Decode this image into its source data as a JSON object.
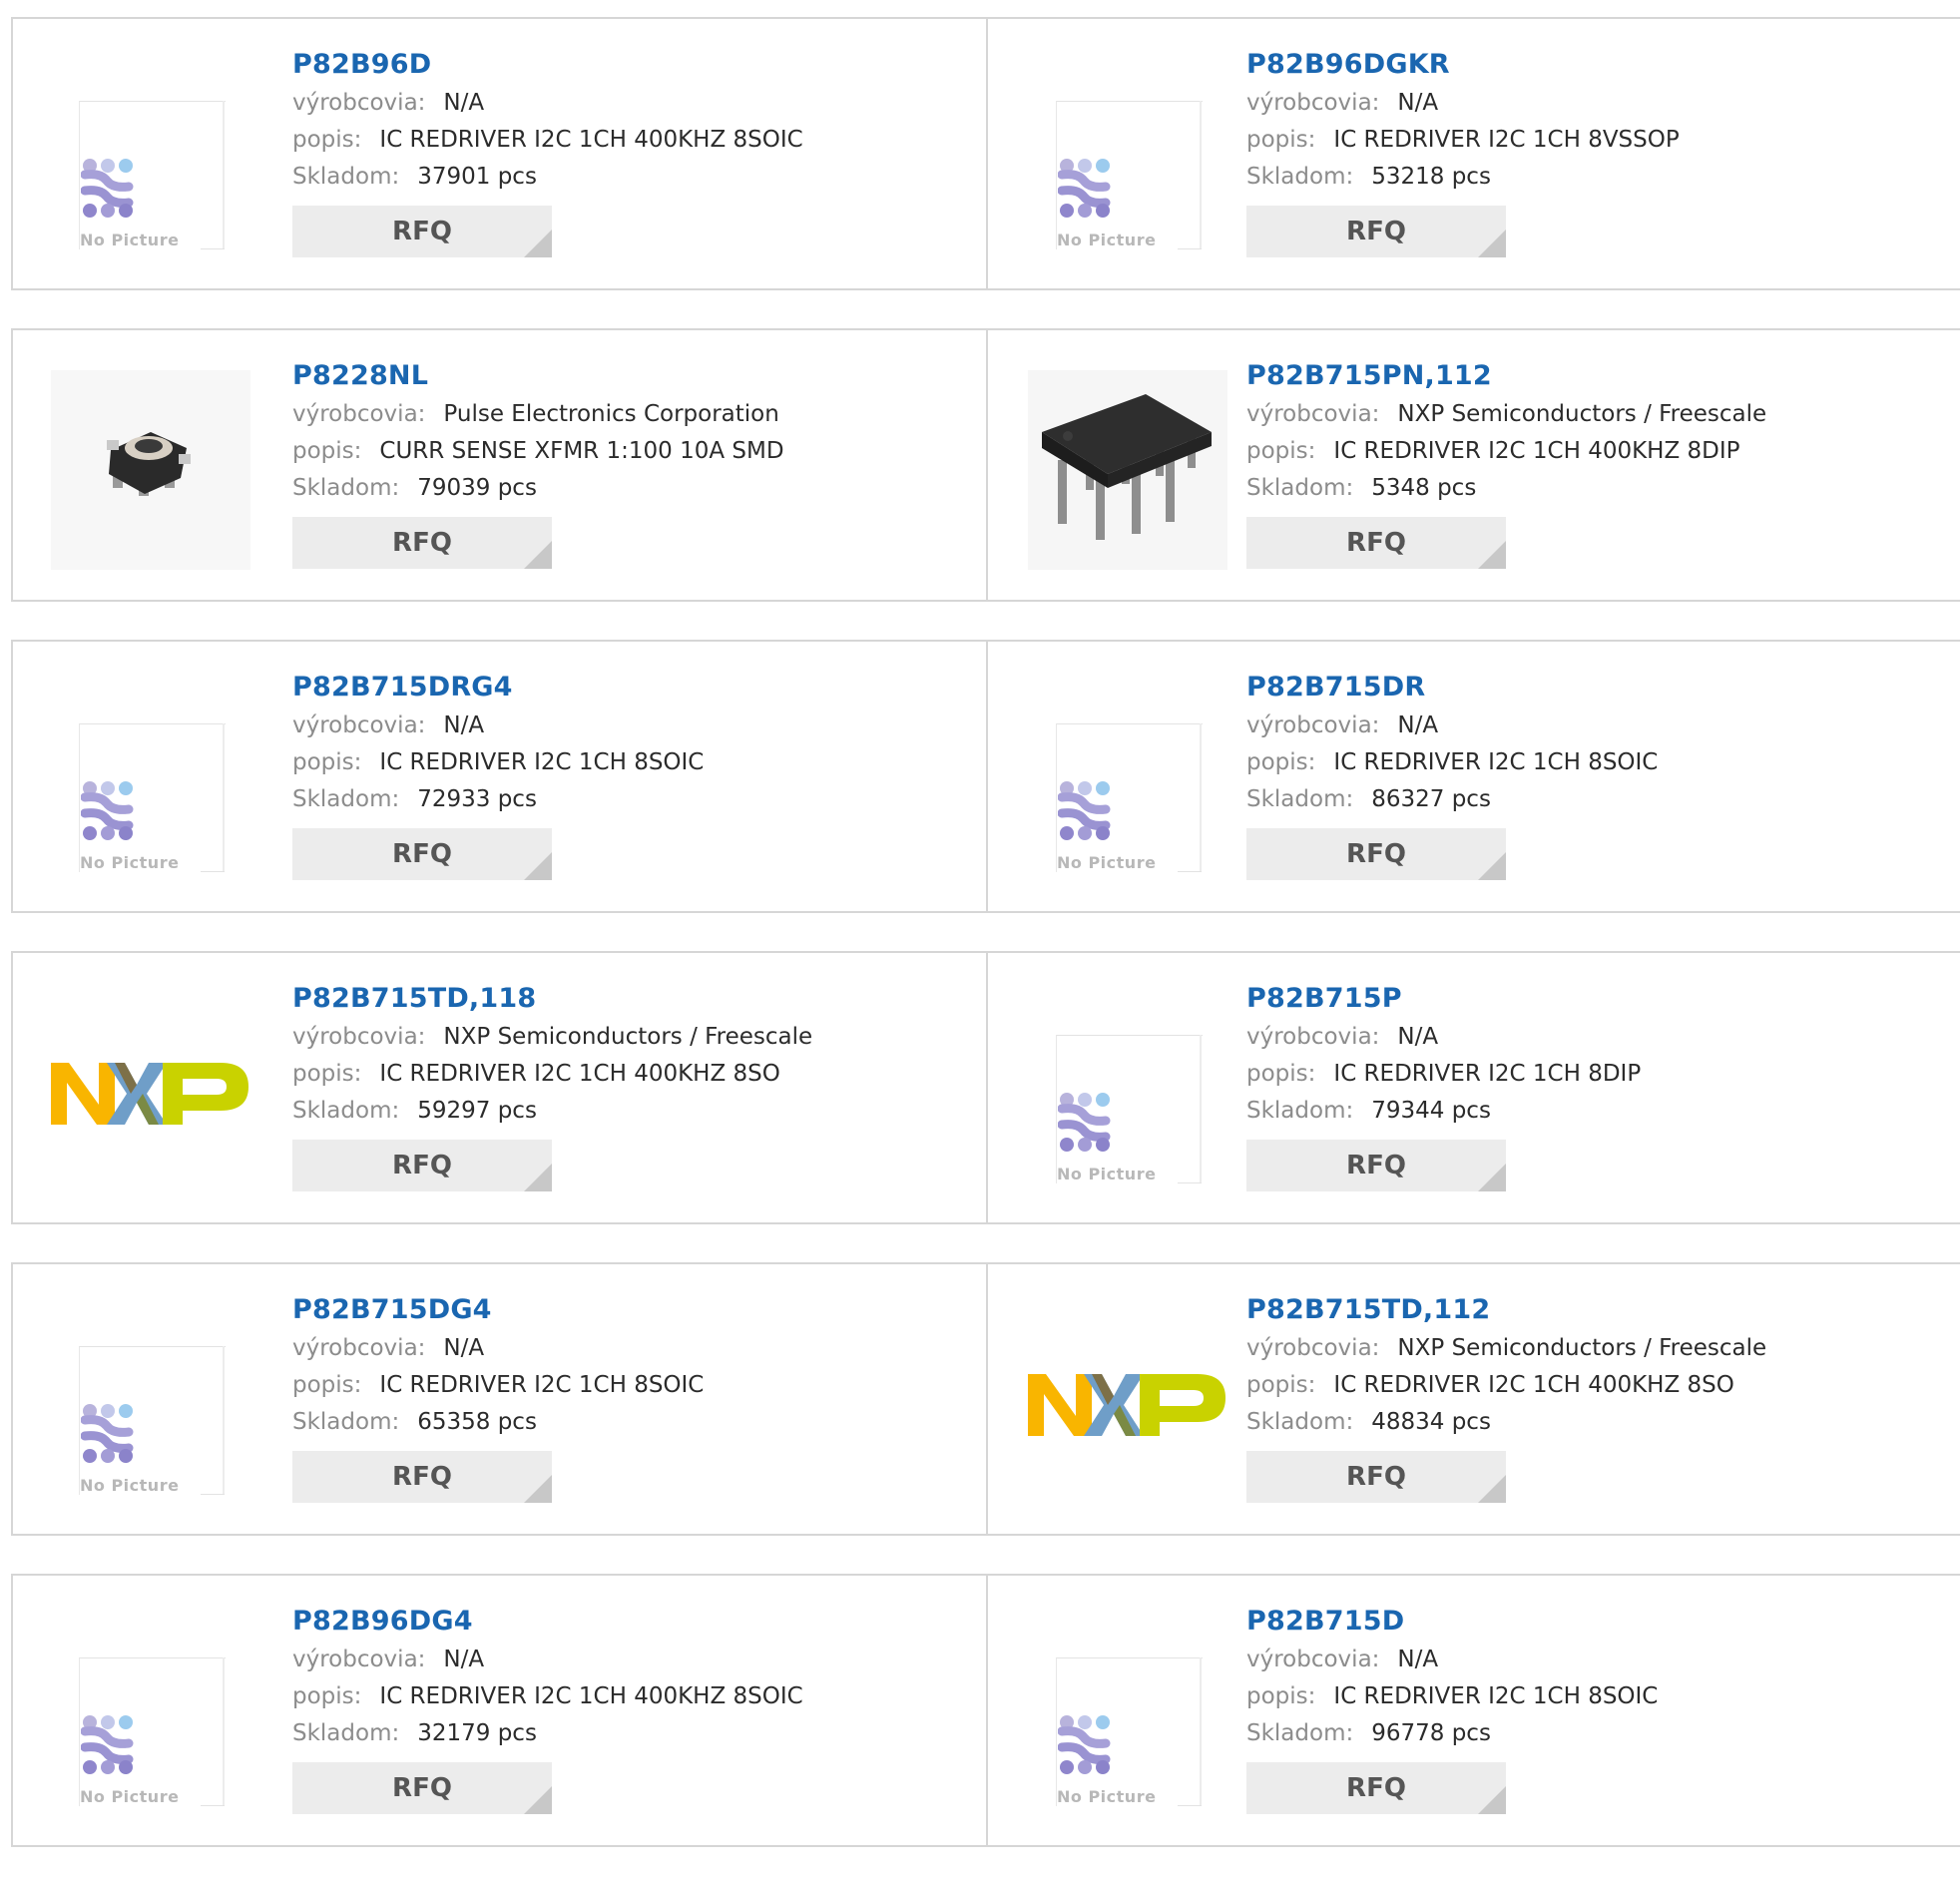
{
  "labels": {
    "manufacturer": "výrobcovia:",
    "description": "popis:",
    "stock": "Skladom:",
    "rfq": "RFQ",
    "no_picture": "No Picture"
  },
  "colors": {
    "part_link": "#1a66b0",
    "label": "#8c8c8c",
    "rfq_bg": "#ececec",
    "border": "#d6d6d6"
  },
  "products": [
    {
      "part": "P82B96D",
      "manufacturer": "N/A",
      "description": "IC REDRIVER I2C 1CH 400KHZ 8SOIC",
      "stock": "37901 pcs",
      "image": "no-picture"
    },
    {
      "part": "P82B96DGKR",
      "manufacturer": "N/A",
      "description": "IC REDRIVER I2C 1CH 8VSSOP",
      "stock": "53218 pcs",
      "image": "no-picture"
    },
    {
      "part": "P8228NL",
      "manufacturer": "Pulse Electronics Corporation",
      "description": "CURR SENSE XFMR 1:100 10A SMD",
      "stock": "79039 pcs",
      "image": "smd-transformer"
    },
    {
      "part": "P82B715PN,112",
      "manufacturer": "NXP Semiconductors / Freescale",
      "description": "IC REDRIVER I2C 1CH 400KHZ 8DIP",
      "stock": "5348 pcs",
      "image": "dip-chip"
    },
    {
      "part": "P82B715DRG4",
      "manufacturer": "N/A",
      "description": "IC REDRIVER I2C 1CH 8SOIC",
      "stock": "72933 pcs",
      "image": "no-picture"
    },
    {
      "part": "P82B715DR",
      "manufacturer": "N/A",
      "description": "IC REDRIVER I2C 1CH 8SOIC",
      "stock": "86327 pcs",
      "image": "no-picture"
    },
    {
      "part": "P82B715TD,118",
      "manufacturer": "NXP Semiconductors / Freescale",
      "description": "IC REDRIVER I2C 1CH 400KHZ 8SO",
      "stock": "59297 pcs",
      "image": "nxp-logo"
    },
    {
      "part": "P82B715P",
      "manufacturer": "N/A",
      "description": "IC REDRIVER I2C 1CH 8DIP",
      "stock": "79344 pcs",
      "image": "no-picture"
    },
    {
      "part": "P82B715DG4",
      "manufacturer": "N/A",
      "description": "IC REDRIVER I2C 1CH 8SOIC",
      "stock": "65358 pcs",
      "image": "no-picture"
    },
    {
      "part": "P82B715TD,112",
      "manufacturer": "NXP Semiconductors / Freescale",
      "description": "IC REDRIVER I2C 1CH 400KHZ 8SO",
      "stock": "48834 pcs",
      "image": "nxp-logo"
    },
    {
      "part": "P82B96DG4",
      "manufacturer": "N/A",
      "description": "IC REDRIVER I2C 1CH 400KHZ 8SOIC",
      "stock": "32179 pcs",
      "image": "no-picture"
    },
    {
      "part": "P82B715D",
      "manufacturer": "N/A",
      "description": "IC REDRIVER I2C 1CH 8SOIC",
      "stock": "96778 pcs",
      "image": "no-picture"
    }
  ]
}
